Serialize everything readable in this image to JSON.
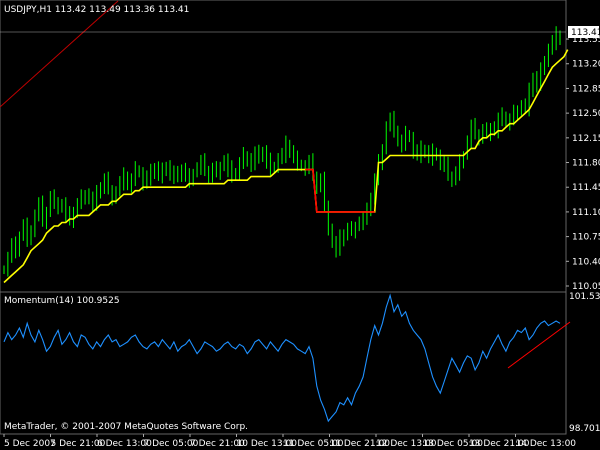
{
  "window": {
    "header_text": "USDJPY,H1  113.42 113.49 113.36 113.41",
    "watermark": "MetaTrader, © 2001-2007 MetaQuotes Software Corp."
  },
  "colors": {
    "background": "#000000",
    "candles": "#00ff00",
    "ma_line": "#ffff00",
    "ma_line_break": "#ff0000",
    "momentum_line": "#1e90ff",
    "trend_line": "#ff0000",
    "grid": "#646464",
    "axis_text": "#ffffff"
  },
  "chart_data": [
    {
      "type": "line",
      "panel": "price",
      "title": "USDJPY,H1  113.42 113.49 113.36 113.41",
      "ylim": [
        110.05,
        113.82
      ],
      "y_ticks": [
        "113.55",
        "113.20",
        "112.85",
        "112.50",
        "112.15",
        "111.80",
        "111.45",
        "111.10",
        "110.75",
        "110.40",
        "110.05"
      ],
      "current_price": "113.41",
      "x_ticks": [
        "5 Dec 2007",
        "5 Dec 21:00",
        "6 Dec 13:00",
        "7 Dec 05:00",
        "7 Dec 21:00",
        "10 Dec 13:00",
        "11 Dec 05:00",
        "11 Dec 21:00",
        "12 Dec 13:00",
        "13 Dec 05:00",
        "13 Dec 21:00",
        "14 Dec 13:00"
      ],
      "x": [
        0,
        1,
        2,
        3,
        4,
        5,
        6,
        7,
        8,
        9,
        10,
        11,
        12,
        13,
        14,
        15,
        16,
        17,
        18,
        19,
        20,
        21,
        22,
        23,
        24,
        25,
        26,
        27,
        28,
        29,
        30,
        31,
        32,
        33,
        34,
        35,
        36,
        37,
        38,
        39,
        40,
        41,
        42,
        43,
        44,
        45,
        46,
        47,
        48,
        49,
        50,
        51,
        52,
        53,
        54,
        55,
        56,
        57,
        58,
        59,
        60,
        61,
        62,
        63,
        64,
        65,
        66,
        67,
        68,
        69,
        70,
        71,
        72,
        73,
        74,
        75,
        76,
        77,
        78,
        79,
        80,
        81,
        82,
        83,
        84,
        85,
        86,
        87,
        88,
        89,
        90,
        91,
        92,
        93,
        94,
        95,
        96,
        97,
        98,
        99,
        100,
        101,
        102,
        103,
        104,
        105,
        106,
        107,
        108,
        109,
        110,
        111,
        112,
        113,
        114,
        115,
        116,
        117,
        118,
        119,
        120,
        121,
        122,
        123,
        124,
        125,
        126,
        127,
        128,
        129,
        130,
        131,
        132,
        133,
        134,
        135,
        136,
        137,
        138,
        139,
        140,
        141,
        142,
        143,
        144
      ],
      "series": [
        {
          "values": [
            110.28,
            110.45,
            110.62,
            110.55,
            110.75,
            110.9,
            110.7,
            110.85,
            111.05,
            111.2,
            110.95,
            111.1,
            111.3,
            111.25,
            111.15,
            111.2,
            111.05,
            110.98,
            111.1,
            111.2,
            111.3,
            111.35,
            111.28,
            111.2,
            111.35,
            111.45,
            111.55,
            111.42,
            111.3,
            111.38,
            111.5,
            111.6,
            111.48,
            111.55,
            111.7,
            111.65,
            111.5,
            111.58,
            111.65,
            111.72,
            111.6,
            111.68,
            111.75,
            111.65,
            111.58,
            111.62,
            111.7,
            111.6,
            111.55,
            111.65,
            111.72,
            111.8,
            111.68,
            111.6,
            111.7,
            111.65,
            111.75,
            111.82,
            111.7,
            111.6,
            111.65,
            111.78,
            111.9,
            111.85,
            111.75,
            111.92,
            111.88,
            111.95,
            111.82,
            111.7,
            111.75,
            111.85,
            111.9,
            112.05,
            111.95,
            111.85,
            111.78,
            111.75,
            111.72,
            111.8,
            111.6,
            111.45,
            111.55,
            111.2,
            110.85,
            110.65,
            110.55,
            110.72,
            110.78,
            110.85,
            110.82,
            110.9,
            110.95,
            111.0,
            111.1,
            111.3,
            111.55,
            111.8,
            112.0,
            112.3,
            112.4,
            112.25,
            112.1,
            112.05,
            112.2,
            112.15,
            111.95,
            111.9,
            111.98,
            111.95,
            111.85,
            111.95,
            111.9,
            111.8,
            111.75,
            111.6,
            111.55,
            111.65,
            111.8,
            111.9,
            112.1,
            112.3,
            112.2,
            112.15,
            112.25,
            112.2,
            112.3,
            112.25,
            112.4,
            112.45,
            112.35,
            112.4,
            112.5,
            112.55,
            112.6,
            112.55,
            112.8,
            113.0,
            112.9,
            113.1,
            113.25,
            113.4,
            113.5,
            113.6,
            113.55,
            113.45,
            113.42,
            113.45,
            113.41
          ]
        },
        {
          "values": [
            110.1,
            110.15,
            110.2,
            110.25,
            110.3,
            110.35,
            110.45,
            110.55,
            110.6,
            110.65,
            110.7,
            110.8,
            110.85,
            110.9,
            110.9,
            110.95,
            110.95,
            111.0,
            111.0,
            111.05,
            111.05,
            111.05,
            111.05,
            111.1,
            111.15,
            111.2,
            111.2,
            111.2,
            111.25,
            111.25,
            111.3,
            111.35,
            111.35,
            111.35,
            111.4,
            111.4,
            111.45,
            111.45,
            111.45,
            111.45,
            111.45,
            111.45,
            111.45,
            111.45,
            111.45,
            111.45,
            111.45,
            111.45,
            111.5,
            111.5,
            111.5,
            111.5,
            111.5,
            111.5,
            111.5,
            111.5,
            111.5,
            111.5,
            111.55,
            111.55,
            111.55,
            111.55,
            111.55,
            111.55,
            111.6,
            111.6,
            111.6,
            111.6,
            111.6,
            111.6,
            111.65,
            111.7,
            111.7,
            111.7,
            111.7,
            111.7,
            111.7,
            111.7,
            111.7,
            111.7,
            111.7,
            111.1,
            111.1,
            111.1,
            111.1,
            111.1,
            111.1,
            111.1,
            111.1,
            111.1,
            111.1,
            111.1,
            111.1,
            111.1,
            111.1,
            111.1,
            111.1,
            111.8,
            111.8,
            111.85,
            111.9,
            111.9,
            111.9,
            111.9,
            111.9,
            111.9,
            111.9,
            111.9,
            111.9,
            111.9,
            111.9,
            111.9,
            111.9,
            111.9,
            111.9,
            111.9,
            111.9,
            111.9,
            111.9,
            111.9,
            111.95,
            112.0,
            112.0,
            112.1,
            112.15,
            112.15,
            112.2,
            112.2,
            112.25,
            112.25,
            112.3,
            112.35,
            112.35,
            112.4,
            112.45,
            112.5,
            112.55,
            112.65,
            112.75,
            112.85,
            112.95,
            113.05,
            113.15,
            113.2,
            113.25,
            113.3,
            113.4
          ]
        }
      ]
    },
    {
      "type": "line",
      "panel": "indicator",
      "title": "Momentum(14) 100.9525",
      "ylim": [
        98.7014,
        101.5367
      ],
      "y_ticks": [
        "101.5367",
        "98.7014"
      ],
      "x": [
        0,
        1,
        2,
        3,
        4,
        5,
        6,
        7,
        8,
        9,
        10,
        11,
        12,
        13,
        14,
        15,
        16,
        17,
        18,
        19,
        20,
        21,
        22,
        23,
        24,
        25,
        26,
        27,
        28,
        29,
        30,
        31,
        32,
        33,
        34,
        35,
        36,
        37,
        38,
        39,
        40,
        41,
        42,
        43,
        44,
        45,
        46,
        47,
        48,
        49,
        50,
        51,
        52,
        53,
        54,
        55,
        56,
        57,
        58,
        59,
        60,
        61,
        62,
        63,
        64,
        65,
        66,
        67,
        68,
        69,
        70,
        71,
        72,
        73,
        74,
        75,
        76,
        77,
        78,
        79,
        80,
        81,
        82,
        83,
        84,
        85,
        86,
        87,
        88,
        89,
        90,
        91,
        92,
        93,
        94,
        95,
        96,
        97,
        98,
        99,
        100,
        101,
        102,
        103,
        104,
        105,
        106,
        107,
        108,
        109,
        110,
        111,
        112,
        113,
        114,
        115,
        116,
        117,
        118,
        119,
        120,
        121,
        122,
        123,
        124,
        125,
        126,
        127,
        128,
        129,
        130,
        131,
        132,
        133,
        134,
        135,
        136,
        137,
        138,
        139,
        140,
        141,
        142,
        143,
        144
      ],
      "series": [
        {
          "values": [
            100.55,
            100.75,
            100.6,
            100.7,
            100.85,
            100.65,
            100.95,
            100.7,
            100.55,
            100.8,
            100.6,
            100.35,
            100.45,
            100.65,
            100.8,
            100.5,
            100.6,
            100.75,
            100.55,
            100.45,
            100.7,
            100.65,
            100.5,
            100.4,
            100.55,
            100.45,
            100.6,
            100.7,
            100.55,
            100.6,
            100.45,
            100.5,
            100.55,
            100.65,
            100.7,
            100.55,
            100.45,
            100.4,
            100.5,
            100.55,
            100.45,
            100.6,
            100.5,
            100.4,
            100.55,
            100.35,
            100.45,
            100.5,
            100.6,
            100.45,
            100.3,
            100.4,
            100.55,
            100.5,
            100.45,
            100.35,
            100.4,
            100.5,
            100.55,
            100.45,
            100.4,
            100.5,
            100.45,
            100.3,
            100.4,
            100.55,
            100.6,
            100.5,
            100.4,
            100.55,
            100.45,
            100.35,
            100.5,
            100.6,
            100.55,
            100.5,
            100.4,
            100.35,
            100.3,
            100.45,
            100.2,
            99.6,
            99.3,
            99.1,
            98.85,
            98.95,
            99.05,
            99.25,
            99.2,
            99.35,
            99.2,
            99.45,
            99.6,
            99.8,
            100.2,
            100.6,
            100.9,
            100.7,
            100.95,
            101.3,
            101.55,
            101.2,
            101.35,
            101.1,
            101.2,
            100.95,
            100.8,
            100.7,
            100.6,
            100.4,
            100.1,
            99.8,
            99.6,
            99.45,
            99.7,
            99.95,
            100.2,
            100.05,
            99.9,
            100.1,
            100.25,
            100.2,
            99.95,
            100.1,
            100.35,
            100.2,
            100.4,
            100.55,
            100.7,
            100.5,
            100.35,
            100.55,
            100.65,
            100.8,
            100.75,
            100.85,
            100.6,
            100.7,
            100.85,
            100.95,
            101.0,
            100.9,
            100.95,
            101.0,
            100.95
          ]
        }
      ]
    }
  ]
}
